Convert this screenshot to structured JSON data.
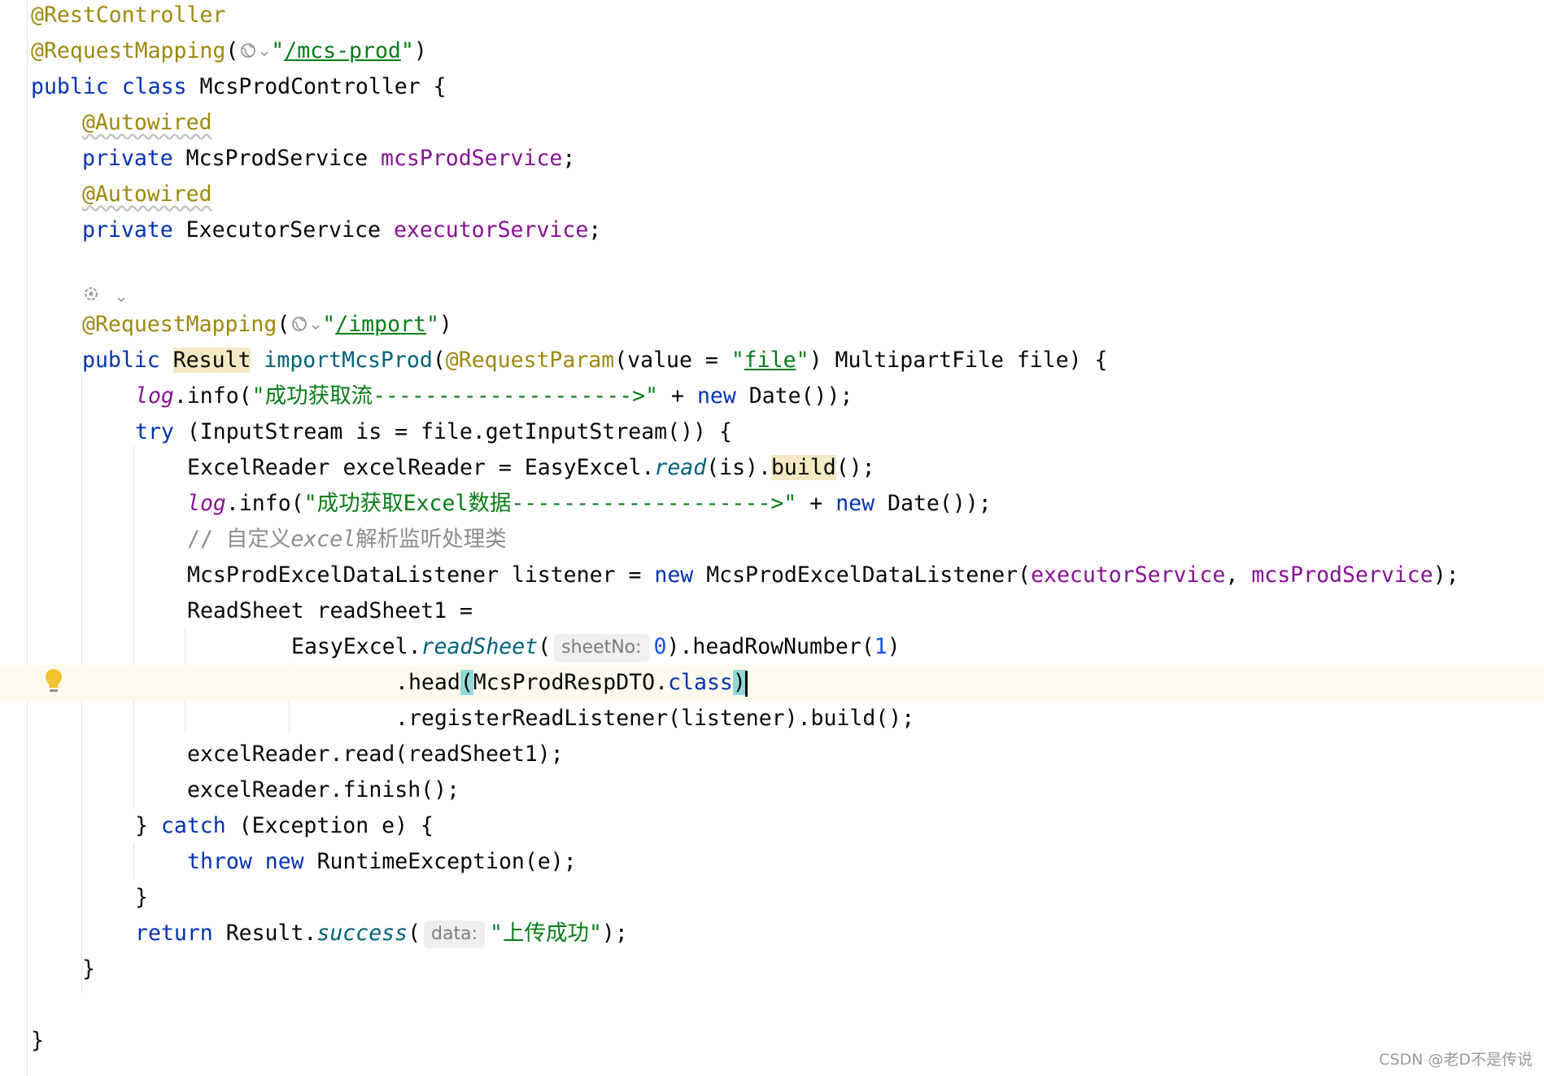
{
  "editor": {
    "language": "Java",
    "hints": {
      "sheet_no": "sheetNo:",
      "data": "data:"
    },
    "icons": {
      "web_endpoint": "globe-icon",
      "dropdown": "chevron-down-icon",
      "spring_bean": "spring-gear-icon",
      "intention": "lightbulb-icon"
    },
    "colors": {
      "keyword": "#0033b3",
      "annotation": "#9e880d",
      "field": "#871094",
      "string": "#067d17",
      "number": "#1750eb",
      "comment": "#8c8c8c",
      "method": "#00627a",
      "current_line": "#fcfaed",
      "brace_match": "#93d9d9",
      "usage_highlight": "#f5e9c4"
    },
    "tokens": {
      "rest_controller": "@RestController",
      "request_mapping": "@RequestMapping",
      "open_paren": "(",
      "close_paren": ")",
      "quote": "\"",
      "mcs_prod_path": "/mcs-prod",
      "public": "public",
      "class": "class",
      "controller_name": "McsProdController",
      "open_brace": " {",
      "close_brace": "}",
      "autowired": "@Autowired",
      "private": "private",
      "mcs_prod_service_type": "McsProdService",
      "mcs_prod_service_field": "mcsProdService",
      "semicolon": ";",
      "executor_service_type": "ExecutorService",
      "executor_service_field": "executorService",
      "import_path": "/import",
      "result": "Result",
      "import_method": "importMcsProd",
      "request_param": "@RequestParam",
      "value_eq": "(value = ",
      "file_str": "file",
      "multipart": ") MultipartFile file) {",
      "log": "log",
      "info_open": ".info(",
      "log_msg_1": "\"成功获取流-------------------->\"",
      "plus": " + ",
      "new": "new",
      "date_end": " Date());",
      "try": "try",
      "try_rest": " (InputStream is = file.getInputStream()) {",
      "excel_reader_decl": "ExcelReader excelReader = EasyExcel.",
      "read": "read",
      "read_is": "(is).",
      "build": "build",
      "build_end": "();",
      "log_msg_2": "\"成功获取Excel数据-------------------->\"",
      "comment_prefix": "// 自定义",
      "comment_excel": "excel",
      "comment_suffix": "解析监听处理类",
      "listener_decl": "McsProdExcelDataListener listener = ",
      "listener_ctor": " McsProdExcelDataListener(",
      "comma": ", ",
      "call_end": ");",
      "read_sheet_decl": "ReadSheet readSheet1 =",
      "easy_excel_dot": "EasyExcel.",
      "read_sheet": "readSheet",
      "zero": "0",
      "head_row": ").headRowNumber(",
      "one": "1",
      "head_dot": ".head",
      "dto_class": "McsProdRespDTO.",
      "register": ".registerReadListener(listener).build();",
      "read_call": "excelReader.read(readSheet1);",
      "finish_call": "excelReader.finish();",
      "catch_open": "} ",
      "catch": "catch",
      "catch_rest": " (Exception e) {",
      "throw": "throw",
      "runtime_exc": " RuntimeException(e);",
      "return": "return",
      "result_dot": " Result.",
      "success": "success",
      "upload_msg": "\"上传成功\""
    }
  },
  "watermark": "CSDN @老D不是传说"
}
